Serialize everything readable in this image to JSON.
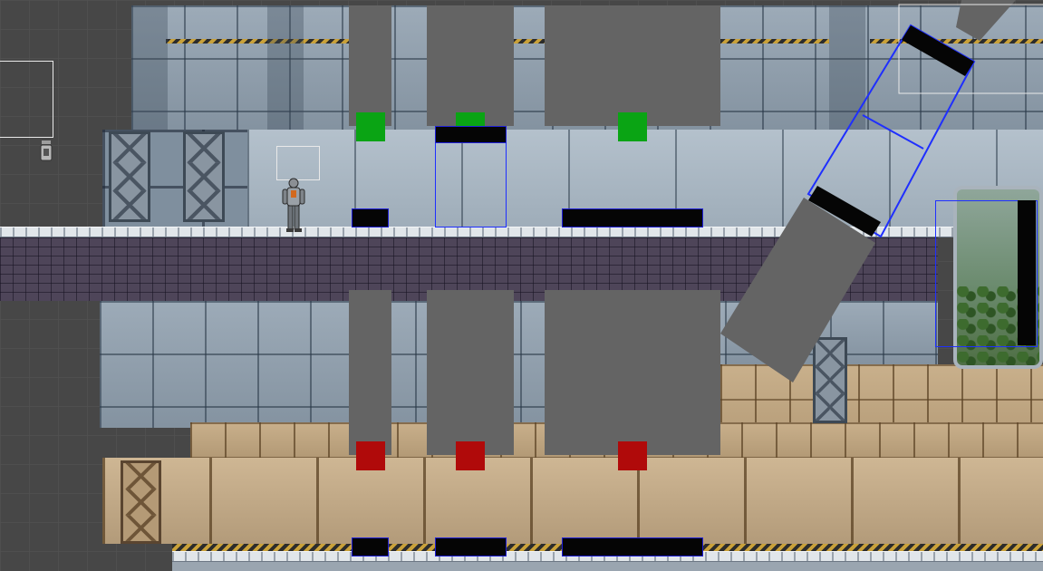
{
  "scene": {
    "view": "scene-editor",
    "colors": {
      "editor_background": "#474747",
      "metal_wall": "#8f9fae",
      "corridor_floor": "#4e4559",
      "sand_wall": "#bda27c",
      "gray_block": "#646464",
      "trigger_green": "#0aa414",
      "trigger_red": "#b00a0a",
      "collider_outline": "#1f2fff",
      "selection_outline": "#e9e9e9",
      "platform_black": "#050505"
    },
    "objects": {
      "player": "player-character",
      "camera_gizmo": "camera-icon",
      "green_triggers": 3,
      "red_triggers": 3,
      "gray_blocks": 7,
      "rotated_gray_blocks": 2,
      "black_platforms": 8
    }
  }
}
